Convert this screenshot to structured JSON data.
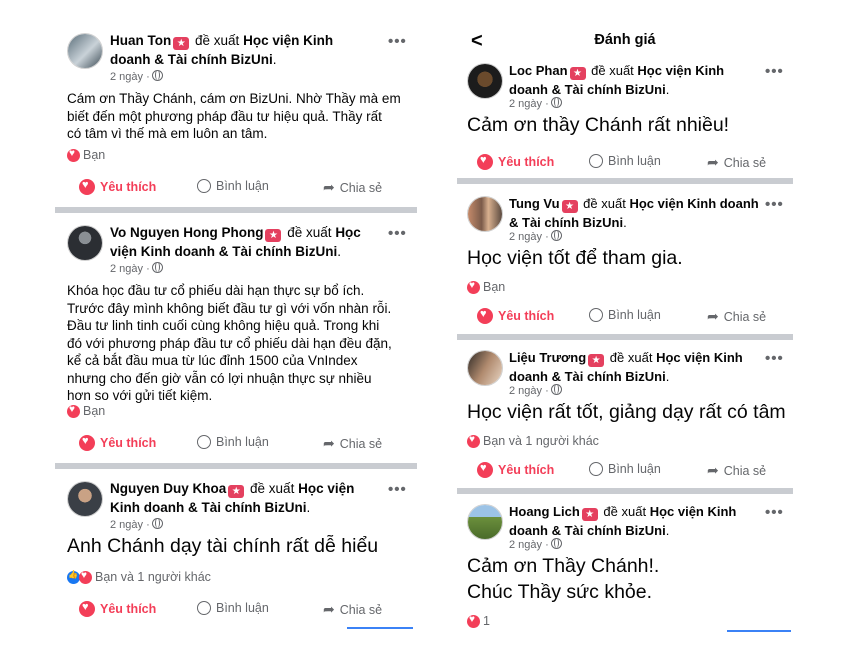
{
  "left_posts": [
    {
      "name": "Huan Ton",
      "recommends": "đề xuất",
      "page_l1": "Học viện Kinh",
      "page_l2": "doanh & Tài chính BizUni",
      "line2_pre": "",
      "time": "2 ngày ·",
      "text": [
        "Cám ơn Thầy Chánh, cám ơn BizUni. Nhờ Thầy mà em",
        "biết đến một phương pháp đầu tư hiệu quả. Thầy rất",
        "có tâm vì thế mà em luôn an tâm."
      ],
      "reactions": "Bạn"
    },
    {
      "name": "Vo Nguyen Hong Phong",
      "recommends": "đề xuất",
      "page_l1": "Học",
      "page_l2": "viện Kinh doanh & Tài chính BizUni",
      "time": "2 ngày ·",
      "text": [
        "Khóa học đầu tư cổ phiếu dài hạn thực sự bổ ích.",
        "Trước đây mình không biết đầu tư gì với vốn nhàn rỗi.",
        "Đầu tư linh tinh cuối cùng không hiệu quả. Trong khi",
        "đó với phương pháp đầu tư cổ phiếu dài hạn đều đặn,",
        "kể cả bắt đầu mua từ lúc đỉnh 1500 của VnIndex",
        "nhưng cho đến giờ vẫn có lợi nhuận thực sự nhiều",
        "hơn so với gửi tiết kiệm."
      ],
      "reactions": "Bạn"
    },
    {
      "name": "Nguyen Duy Khoa",
      "recommends": "đề xuất",
      "page_l1": "Học viện",
      "page_l2": "Kinh doanh & Tài chính BizUni",
      "time": "2 ngày ·",
      "text": [
        "Anh Chánh dạy tài chính rất dễ hiểu"
      ],
      "reactions": "Bạn và 1 người khác"
    }
  ],
  "right": {
    "title": "Đánh giá",
    "posts": [
      {
        "name": "Loc Phan",
        "recommends": "đề xuất",
        "page_l1": "Học viện Kinh",
        "page_l2": "doanh & Tài chính BizUni",
        "time": "2 ngày ·",
        "text": [
          "Cảm ơn thầy Chánh rất nhiều!"
        ],
        "reactions": ""
      },
      {
        "name": "Tung Vu",
        "recommends": "đề xuất",
        "page_l1": "Học viện Kinh doanh",
        "page_l2": "& Tài chính BizUni",
        "time": "2 ngày ·",
        "text": [
          "Học viện tốt để tham gia."
        ],
        "reactions": "Bạn"
      },
      {
        "name": "Liệu Trương",
        "recommends": "đề xuất",
        "page_l1": "Học viện Kinh",
        "page_l2": "doanh & Tài chính BizUni",
        "time": "2 ngày ·",
        "text": [
          "Học viện rất tốt, giảng dạy rất có tâm"
        ],
        "reactions": "Bạn và 1 người khác"
      },
      {
        "name": "Hoang Lich",
        "recommends": "đề xuất",
        "page_l1": "Học viện Kinh",
        "page_l2": "doanh & Tài chính BizUni",
        "time": "2 ngày ·",
        "text": [
          "Cảm ơn Thầy Chánh!.",
          "Chúc Thầy sức khỏe."
        ],
        "reactions": "1"
      }
    ]
  },
  "actions": {
    "like": "Yêu thích",
    "comment": "Bình luận",
    "share": "Chia sẻ"
  },
  "more": "•••",
  "colors": {
    "like": "#f33e58",
    "badge": "#e4405f",
    "secondary": "#65676b",
    "separator": "#c9ccd1"
  }
}
